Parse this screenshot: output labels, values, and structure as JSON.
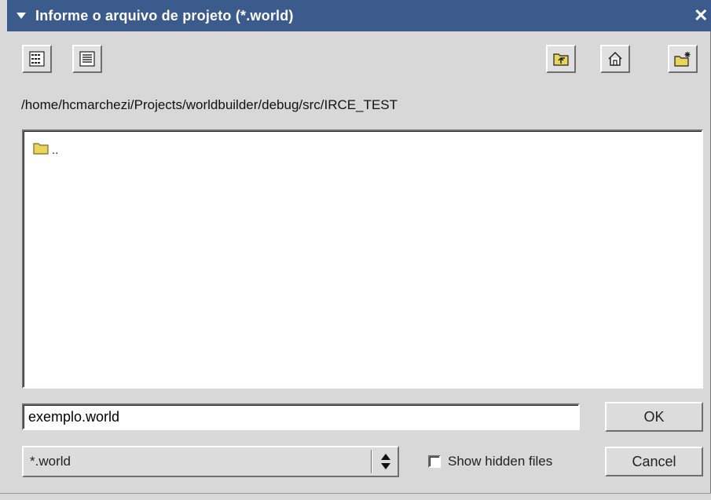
{
  "dialog": {
    "title": "Informe o arquivo de projeto (*.world)",
    "close_glyph": "✕"
  },
  "toolbar": {
    "left_buttons": [
      {
        "name": "list-view-button",
        "icon": "list-view-icon"
      },
      {
        "name": "detail-view-button",
        "icon": "detail-view-icon"
      }
    ],
    "right_buttons": [
      {
        "name": "parent-folder-button",
        "icon": "folder-up-icon"
      },
      {
        "name": "home-button",
        "icon": "home-icon"
      },
      {
        "name": "new-folder-button",
        "icon": "new-folder-icon"
      }
    ]
  },
  "location": {
    "path": "/home/hcmarchezi/Projects/worldbuilder/debug/src/IRCE_TEST"
  },
  "files": [
    {
      "name": "..",
      "type": "folder",
      "icon": "folder-icon"
    }
  ],
  "filename": {
    "value": "exemplo.world"
  },
  "filter": {
    "selected": "*.world"
  },
  "show_hidden": {
    "label": "Show hidden files",
    "checked": false
  },
  "buttons": {
    "ok": "OK",
    "cancel": "Cancel"
  },
  "colors": {
    "titlebar": "#3a5b8c",
    "background": "#d8d8d8",
    "folder": "#e8d55a"
  }
}
